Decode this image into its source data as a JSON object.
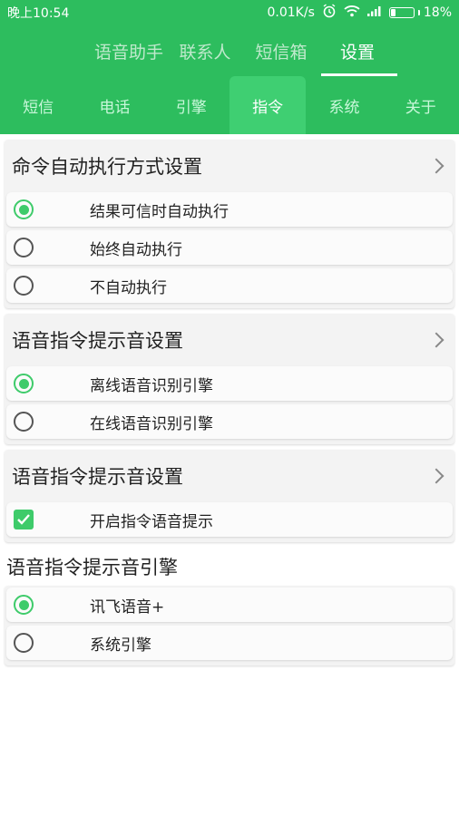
{
  "status_bar": {
    "time": "晚上10:54",
    "speed": "0.01K/s",
    "battery": "18%",
    "battery_level": 0.18
  },
  "top_tabs": [
    {
      "label": "语音助手",
      "active": false
    },
    {
      "label": "联系人",
      "active": false
    },
    {
      "label": "短信箱",
      "active": false
    },
    {
      "label": "设置",
      "active": true
    }
  ],
  "sub_tabs": [
    {
      "label": "短信",
      "active": false
    },
    {
      "label": "电话",
      "active": false
    },
    {
      "label": "引擎",
      "active": false
    },
    {
      "label": "指令",
      "active": true
    },
    {
      "label": "系统",
      "active": false
    },
    {
      "label": "关于",
      "active": false
    }
  ],
  "sections": {
    "auto_exec": {
      "title": "命令自动执行方式设置",
      "options": [
        {
          "label": "结果可信时自动执行",
          "selected": true
        },
        {
          "label": "始终自动执行",
          "selected": false
        },
        {
          "label": "不自动执行",
          "selected": false
        }
      ]
    },
    "prompt_engine": {
      "title": "语音指令提示音设置",
      "options": [
        {
          "label": "离线语音识别引擎",
          "selected": true
        },
        {
          "label": "在线语音识别引擎",
          "selected": false
        }
      ]
    },
    "prompt_sound": {
      "title": "语音指令提示音设置",
      "checkbox": {
        "label": "开启指令语音提示",
        "checked": true
      }
    },
    "sound_engine": {
      "title": "语音指令提示音引擎",
      "options": [
        {
          "label": "讯飞语音+",
          "selected": true
        },
        {
          "label": "系统引擎",
          "selected": false
        }
      ]
    }
  },
  "colors": {
    "primary": "#2dbd5e",
    "accent": "#3ecb6a"
  }
}
